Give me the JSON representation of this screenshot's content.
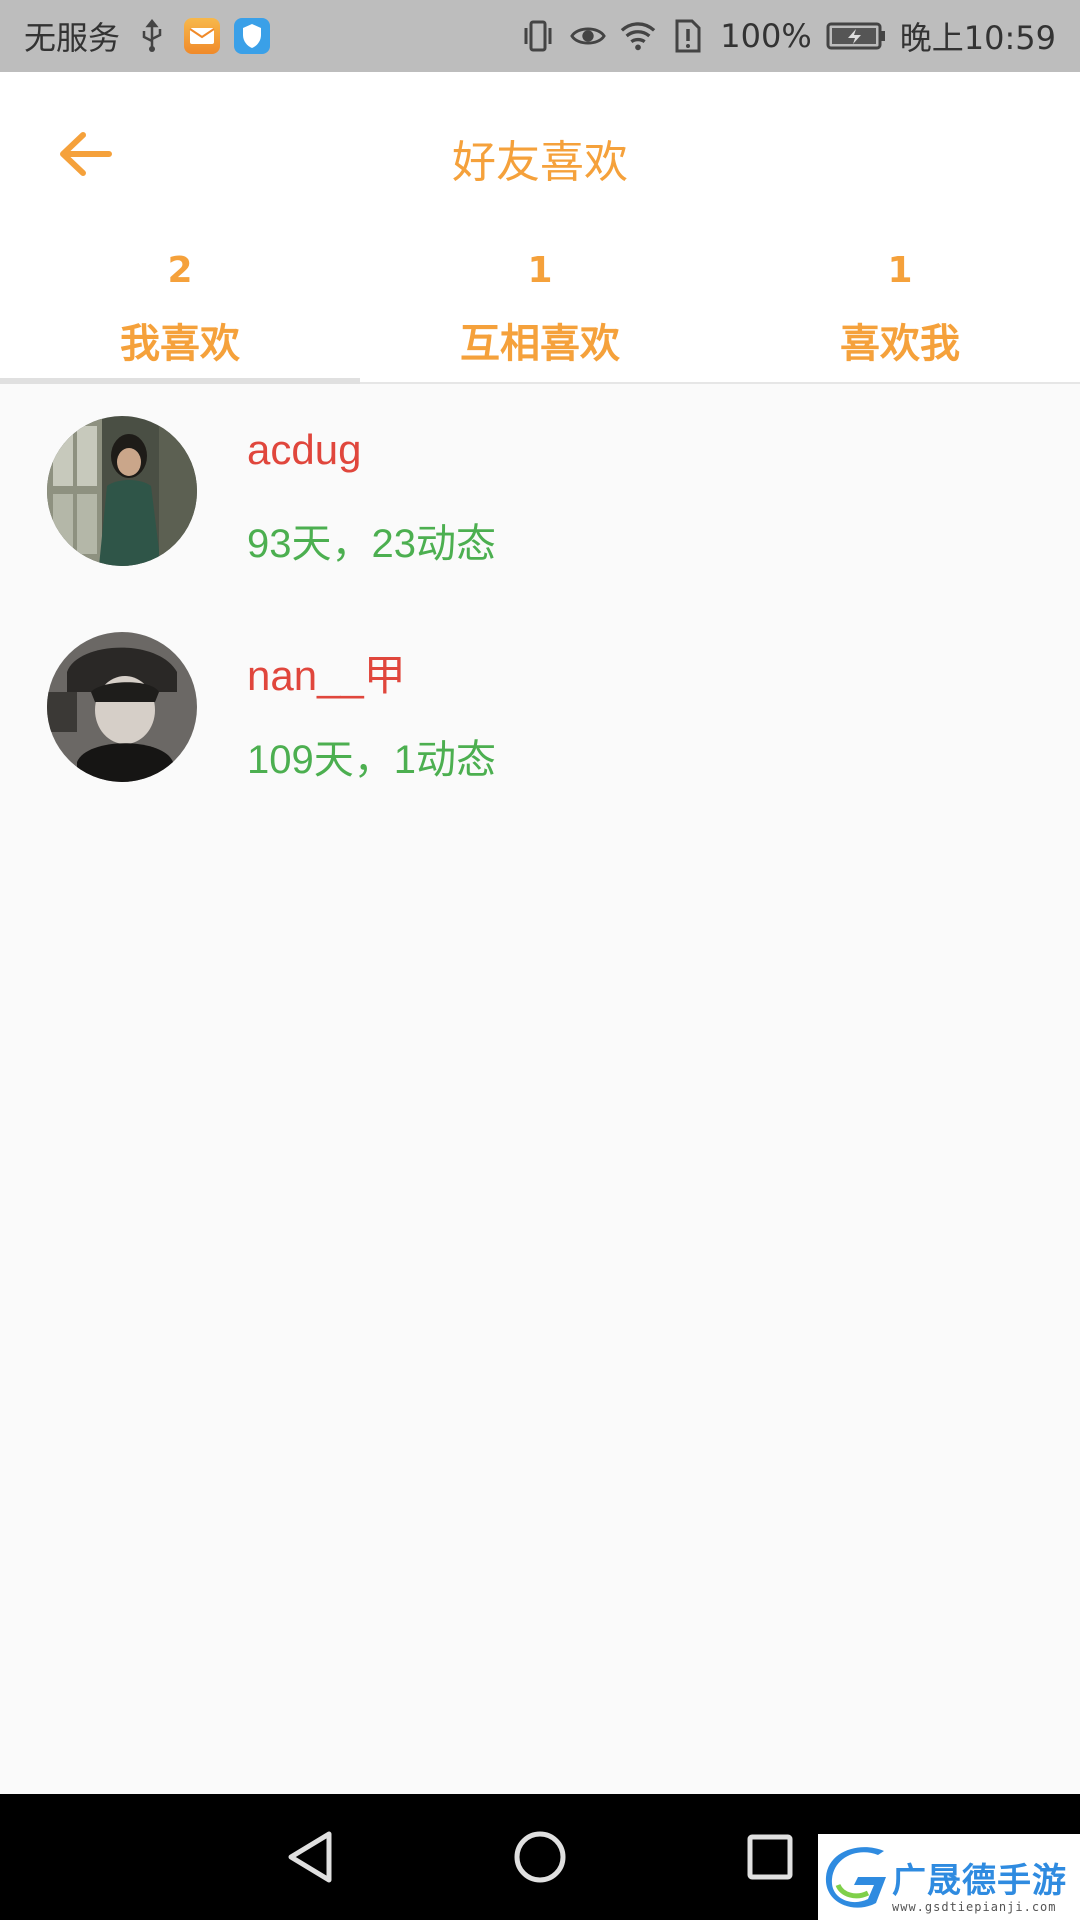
{
  "status_bar": {
    "carrier": "无服务",
    "battery": "100%",
    "time": "晚上10:59",
    "icons": [
      "usb-icon",
      "mail-app-icon",
      "shield-app-icon",
      "vibrate-icon",
      "eye-icon",
      "wifi-icon",
      "sim-alert-icon",
      "battery-charging-icon"
    ]
  },
  "header": {
    "title": "好友喜欢",
    "back_icon": "arrow-left-icon"
  },
  "tabs": [
    {
      "count": "2",
      "label": "我喜欢",
      "active": true
    },
    {
      "count": "1",
      "label": "互相喜欢",
      "active": false
    },
    {
      "count": "1",
      "label": "喜欢我",
      "active": false
    }
  ],
  "list": [
    {
      "name": "acdug",
      "meta": "93天，23动态"
    },
    {
      "name": "nan__甲",
      "meta": "109天，1动态"
    }
  ],
  "nav_bar": {
    "icons": [
      "back-triangle-icon",
      "home-circle-icon",
      "recents-square-icon"
    ]
  },
  "watermark": {
    "text": "广晟德手游",
    "sub": "www.gsdtiepianji.com"
  },
  "colors": {
    "accent": "#f5a13b",
    "name": "#e0463c",
    "meta": "#4caf50",
    "status_bg": "#bdbdbd"
  }
}
